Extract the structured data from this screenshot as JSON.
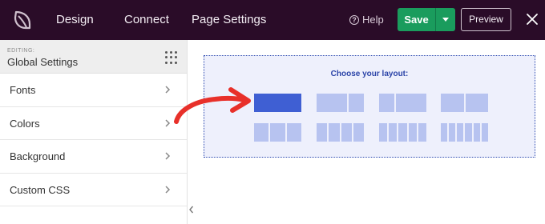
{
  "topbar": {
    "logo_icon": "seedprod-leaf-icon",
    "nav": [
      "Design",
      "Connect",
      "Page Settings"
    ],
    "help_label": "Help",
    "save_label": "Save",
    "preview_label": "Preview",
    "close_icon": "close-icon",
    "colors": {
      "background": "#2a0c28",
      "save": "#1a9c5d"
    }
  },
  "sidebar": {
    "editing_label": "EDITING:",
    "title": "Global Settings",
    "items": [
      {
        "label": "Fonts"
      },
      {
        "label": "Colors"
      },
      {
        "label": "Background"
      },
      {
        "label": "Custom CSS"
      }
    ]
  },
  "layout_picker": {
    "title": "Choose your layout:",
    "selected_index": 0,
    "options": [
      {
        "columns": [
          1
        ]
      },
      {
        "columns": [
          2,
          1
        ]
      },
      {
        "columns": [
          1,
          2
        ]
      },
      {
        "columns": [
          1,
          1
        ]
      },
      {
        "columns": [
          1,
          1,
          1
        ]
      },
      {
        "columns": [
          1,
          1,
          1,
          1
        ]
      },
      {
        "columns": [
          1,
          1,
          1,
          1,
          1
        ]
      },
      {
        "columns": [
          1,
          1,
          1,
          1,
          1,
          1
        ]
      }
    ],
    "colors": {
      "selected": "#3f5fd3",
      "unselected": "#b7c3f0",
      "title": "#2b44a8"
    }
  },
  "annotation": {
    "arrow_color": "#e8302a"
  }
}
